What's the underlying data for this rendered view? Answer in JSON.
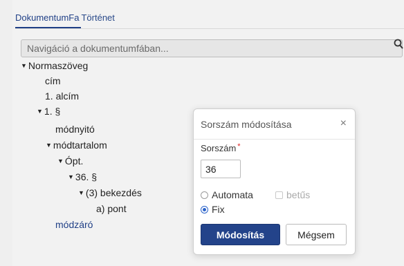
{
  "tabs": [
    {
      "label": "DokumentumFa",
      "active": true
    },
    {
      "label": "Történet",
      "active": false
    }
  ],
  "search": {
    "placeholder": "Navigáció a dokumentumfában..."
  },
  "tree": [
    {
      "label": "Normaszöveg",
      "expanded": true
    },
    {
      "label": "cím"
    },
    {
      "label": "1. alcím"
    },
    {
      "label": "1. §",
      "expanded": true
    },
    {
      "label": "módnyitó"
    },
    {
      "label": "módtartalom",
      "expanded": true
    },
    {
      "label": "Ópt.",
      "expanded": true
    },
    {
      "label": "36. §",
      "expanded": true
    },
    {
      "label": "(3) bekezdés",
      "expanded": true
    },
    {
      "label": "a) pont"
    },
    {
      "label": "módzáró",
      "link": true
    }
  ],
  "modal": {
    "title": "Sorszám módosítása",
    "close": "×",
    "field_label": "Sorszám",
    "required_mark": "*",
    "value": "36",
    "options": {
      "auto": "Automata",
      "letters": "betűs",
      "fixed": "Fix",
      "selected": "Fix"
    },
    "primary_button": "Módosítás",
    "cancel_button": "Mégsem"
  },
  "colors": {
    "accent": "#23438a",
    "link": "#1f3f86"
  }
}
